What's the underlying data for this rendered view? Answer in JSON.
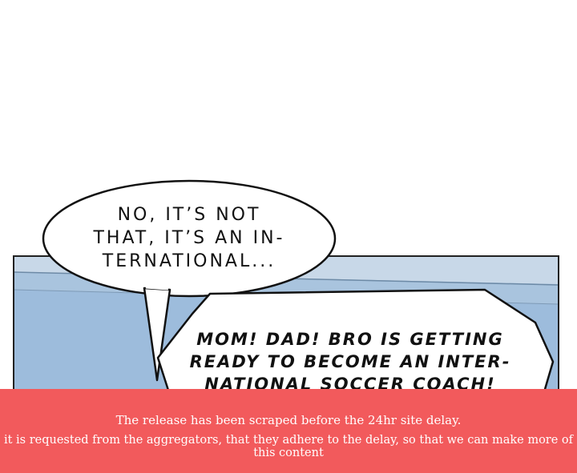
{
  "speech_bubbles": {
    "left_text": "NO, IT'S NOT THAT, IT'S AN IN-TERNATIONAL...",
    "left_lines": [
      "NO, IT’S NOT",
      "THAT, IT’S AN IN-",
      "TERNATIONAL..."
    ],
    "right_lines": [
      "MOM! DAD! BRO IS GETTING",
      "READY TO BECOME AN INTER-",
      "NATIONAL SOCCER COACH!"
    ]
  },
  "notice_banner": {
    "line1": "The release has been scraped before the 24hr site delay.",
    "line2": "it is requested from the aggregators, that they adhere to the delay, so that we can make more of this content"
  },
  "colors": {
    "banner": "#f25a5c",
    "sky": "#8fb4d8",
    "panel_border": "#222222"
  }
}
